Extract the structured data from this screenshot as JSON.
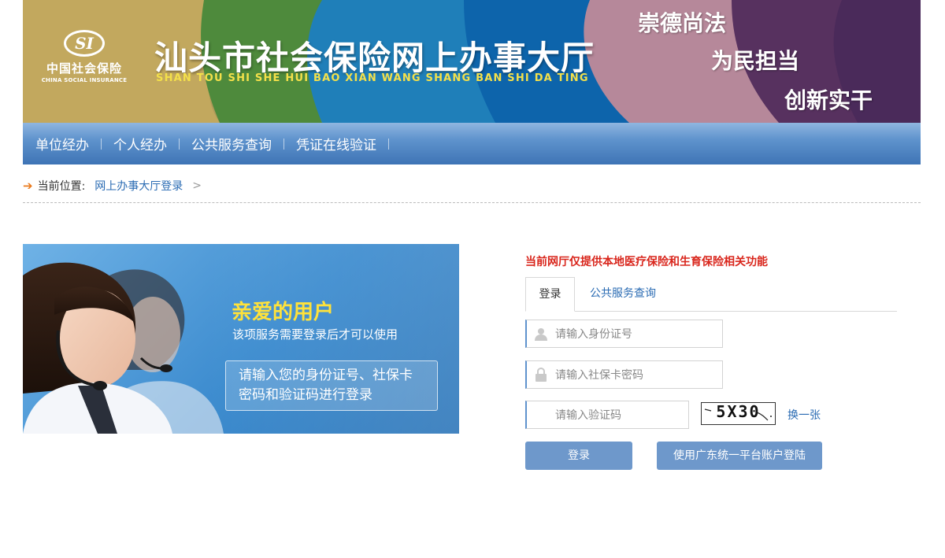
{
  "banner": {
    "logo_cn": "中国社会保险",
    "logo_en": "CHINA SOCIAL INSURANCE",
    "logo_mark": "SI",
    "title": "汕头市社会保险网上办事大厅",
    "subtitle": "SHAN TOU SHI SHE HUI BAO XIAN WANG SHANG BAN SHI DA TING",
    "slogans": [
      "崇德尚法",
      "为民担当",
      "创新实干"
    ]
  },
  "nav": {
    "items": [
      {
        "label": "单位经办"
      },
      {
        "label": "个人经办"
      },
      {
        "label": "公共服务查询"
      },
      {
        "label": "凭证在线验证"
      }
    ]
  },
  "breadcrumb": {
    "prefix": "当前位置:",
    "current": "网上办事大厅登录",
    "separator": ">"
  },
  "promo": {
    "title": "亲爱的用户",
    "description": "该项服务需要登录后才可以使用",
    "box_lines": [
      "请输入您的身份证号、社保卡",
      "密码和验证码进行登录"
    ]
  },
  "login": {
    "notice": "当前网厅仅提供本地医疗保险和生育保险相关功能",
    "tabs": [
      {
        "label": "登录",
        "active": true
      },
      {
        "label": "公共服务查询",
        "active": false
      }
    ],
    "id_placeholder": "请输入身份证号",
    "password_placeholder": "请输入社保卡密码",
    "captcha_placeholder": "请输入验证码",
    "captcha_text": "5X30",
    "refresh_label": "换一张",
    "login_button": "登录",
    "gd_button": "使用广东统一平台账户登陆"
  },
  "colors": {
    "nav": "#5f93cd",
    "link": "#2a6bb3",
    "notice": "#d9261c",
    "button": "#6e98cb",
    "accent_arrow": "#ea7a1c"
  }
}
